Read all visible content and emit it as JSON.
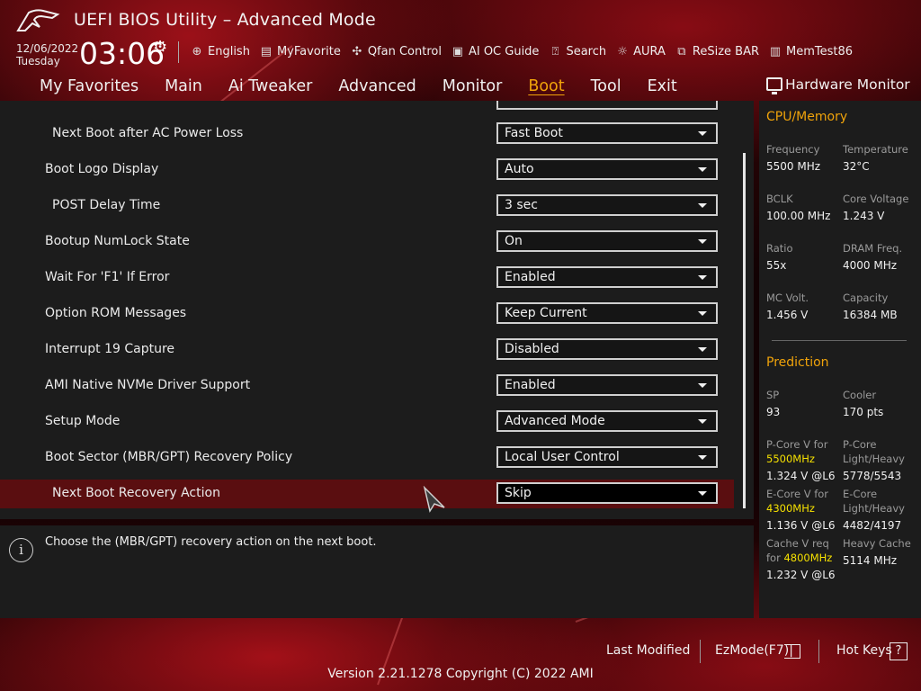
{
  "header": {
    "title": "UEFI BIOS Utility – Advanced Mode",
    "date": "12/06/2022",
    "day": "Tuesday",
    "time": "03:06",
    "tools": [
      {
        "icon": "globe-icon",
        "label": "English"
      },
      {
        "icon": "favorite-list-icon",
        "label": "MyFavorite"
      },
      {
        "icon": "fan-icon",
        "label": "Qfan Control"
      },
      {
        "icon": "ai-chip-icon",
        "label": "AI OC Guide"
      },
      {
        "icon": "question-icon",
        "label": "Search"
      },
      {
        "icon": "aura-light-icon",
        "label": "AURA"
      },
      {
        "icon": "resize-bar-icon",
        "label": "ReSize BAR"
      },
      {
        "icon": "memory-icon",
        "label": "MemTest86"
      }
    ]
  },
  "nav": {
    "items": [
      "My Favorites",
      "Main",
      "Ai Tweaker",
      "Advanced",
      "Monitor",
      "Boot",
      "Tool",
      "Exit"
    ],
    "active": "Boot"
  },
  "settings": {
    "rows": [
      {
        "label": "Next Boot after AC Power Loss",
        "value": "Fast Boot",
        "indent": true
      },
      {
        "label": "Boot Logo Display",
        "value": "Auto",
        "indent": false
      },
      {
        "label": "POST Delay Time",
        "value": "3 sec",
        "indent": true
      },
      {
        "label": "Bootup NumLock State",
        "value": "On",
        "indent": false
      },
      {
        "label": "Wait For 'F1' If Error",
        "value": "Enabled",
        "indent": false
      },
      {
        "label": "Option ROM Messages",
        "value": "Keep Current",
        "indent": false
      },
      {
        "label": "Interrupt 19 Capture",
        "value": "Disabled",
        "indent": false
      },
      {
        "label": "AMI Native NVMe Driver Support",
        "value": "Enabled",
        "indent": false
      },
      {
        "label": "Setup Mode",
        "value": "Advanced Mode",
        "indent": false
      },
      {
        "label": "Boot Sector (MBR/GPT) Recovery Policy",
        "value": "Local User Control",
        "indent": false
      },
      {
        "label": "Next Boot Recovery Action",
        "value": "Skip",
        "indent": true,
        "selected": true
      }
    ]
  },
  "help": {
    "text": "Choose the (MBR/GPT) recovery action on the next boot."
  },
  "hardware_monitor": {
    "title": "Hardware Monitor",
    "cpu_memory": {
      "section": "CPU/Memory",
      "frequency_label": "Frequency",
      "frequency": "5500 MHz",
      "temperature_label": "Temperature",
      "temperature": "32°C",
      "bclk_label": "BCLK",
      "bclk": "100.00 MHz",
      "core_voltage_label": "Core Voltage",
      "core_voltage": "1.243 V",
      "ratio_label": "Ratio",
      "ratio": "55x",
      "dram_freq_label": "DRAM Freq.",
      "dram_freq": "4000 MHz",
      "mc_volt_label": "MC Volt.",
      "mc_volt": "1.456 V",
      "capacity_label": "Capacity",
      "capacity": "16384 MB"
    },
    "prediction": {
      "section": "Prediction",
      "sp_label": "SP",
      "sp": "93",
      "cooler_label": "Cooler",
      "cooler": "170 pts",
      "pcore_v_label": "P-Core V for",
      "pcore_v_freq": "5500MHz",
      "pcore_v": "1.324 V @L6",
      "pcore_lh_label_1": "P-Core",
      "pcore_lh_label_2": "Light/Heavy",
      "pcore_lh": "5778/5543",
      "ecore_v_label": "E-Core V for",
      "ecore_v_freq": "4300MHz",
      "ecore_v": "1.136 V @L6",
      "ecore_lh_label_1": "E-Core",
      "ecore_lh_label_2": "Light/Heavy",
      "ecore_lh": "4482/4197",
      "cache_v_label_1": "Cache V req",
      "cache_v_label_2": "for",
      "cache_v_freq": "4800MHz",
      "cache_v": "1.232 V @L6",
      "heavy_cache_label": "Heavy Cache",
      "heavy_cache": "5114 MHz"
    }
  },
  "footer": {
    "last_modified": "Last Modified",
    "ezmode": "EzMode(F7)|",
    "hotkeys": "Hot Keys",
    "hotkeys_icon_glyph": "?",
    "version": "Version 2.21.1278 Copyright (C) 2022 AMI"
  },
  "colors": {
    "accent": "#f0a30a",
    "highlight_freq": "#f5e000",
    "selected_row": "#5a0e10",
    "panel": "#1c1c1c"
  }
}
